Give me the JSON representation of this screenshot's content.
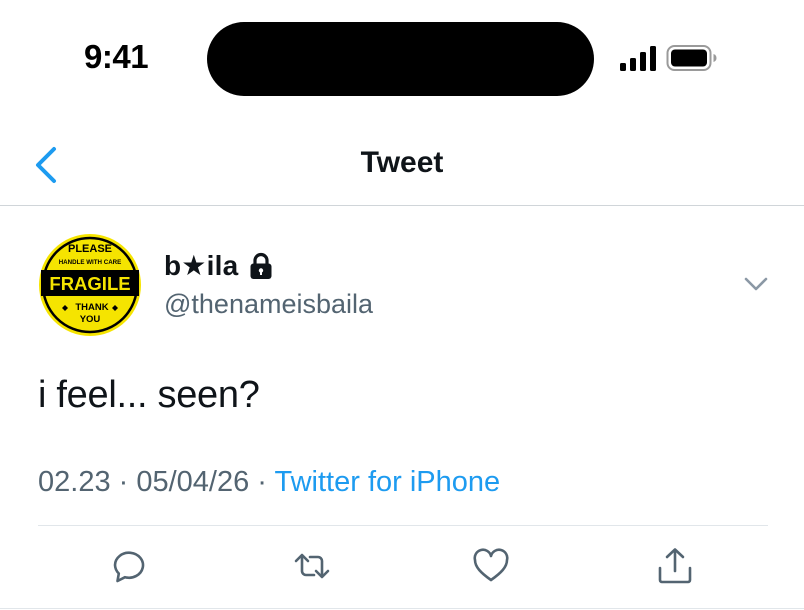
{
  "status_bar": {
    "time": "9:41"
  },
  "nav": {
    "title": "Tweet",
    "back_icon": "chevron-left-icon"
  },
  "tweet": {
    "avatar": {
      "top_text": "PLEASE",
      "sub_text": "HANDLE WITH CARE",
      "main_text": "FRAGILE",
      "bottom_text_1": "THANK",
      "bottom_text_2": "YOU",
      "colors": {
        "background": "#f5e400",
        "ring": "#000000"
      }
    },
    "display_name": "b★ila",
    "handle": "@thenameisbaila",
    "protected_icon": "lock-icon",
    "text": "i feel... seen?",
    "time": "02.23",
    "separator": " · ",
    "date": "05/04/26",
    "source": "Twitter for iPhone"
  },
  "actions": [
    {
      "icon": "reply-icon"
    },
    {
      "icon": "retweet-icon"
    },
    {
      "icon": "like-icon"
    },
    {
      "icon": "share-icon"
    }
  ],
  "colors": {
    "accent": "#1d9bf0",
    "secondary_text": "#536471",
    "primary_text": "#0f1419"
  }
}
